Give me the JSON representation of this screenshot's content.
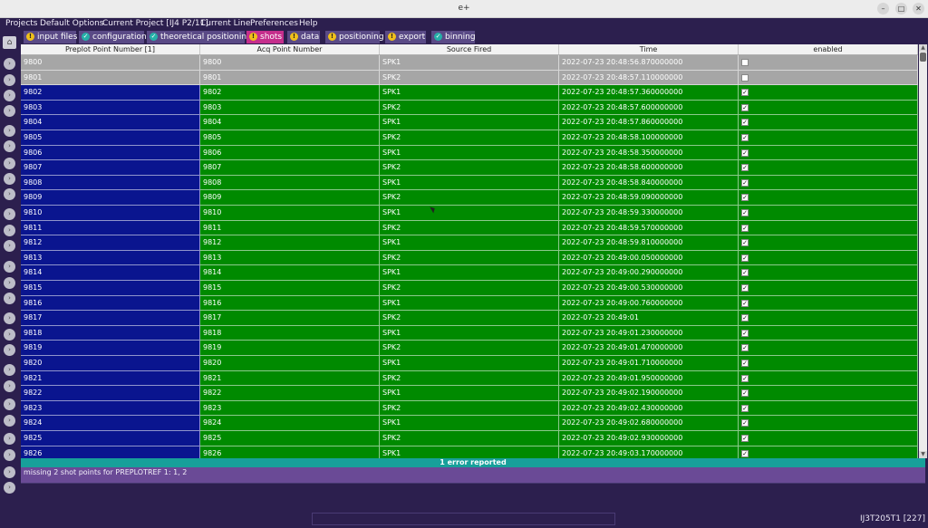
{
  "window": {
    "title": "e+"
  },
  "menu": [
    "Projects",
    "Default Options",
    "Current Project [IJ4 P2/11]",
    "Current Line",
    "Preferences",
    "Help"
  ],
  "tabs": [
    {
      "label": "input files",
      "status": "warning"
    },
    {
      "label": "configuration",
      "status": "ok"
    },
    {
      "label": "theoretical positioning",
      "status": "ok"
    },
    {
      "label": "shots",
      "status": "warning",
      "active": true
    },
    {
      "label": "data",
      "status": "warning"
    },
    {
      "label": "positioning",
      "status": "warning"
    },
    {
      "label": "export",
      "status": "warning"
    },
    {
      "label": "binning",
      "status": "ok"
    }
  ],
  "table": {
    "columns": [
      "Preplot Point Number [1]",
      "Acq Point Number",
      "Source Fired",
      "Time",
      "enabled"
    ],
    "rows": [
      {
        "preplot": "9800",
        "acq": "9800",
        "source": "SPK1",
        "time": "2022-07-23 20:48:56.870000000",
        "enabled": false
      },
      {
        "preplot": "9801",
        "acq": "9801",
        "source": "SPK2",
        "time": "2022-07-23 20:48:57.110000000",
        "enabled": false
      },
      {
        "preplot": "9802",
        "acq": "9802",
        "source": "SPK1",
        "time": "2022-07-23 20:48:57.360000000",
        "enabled": true
      },
      {
        "preplot": "9803",
        "acq": "9803",
        "source": "SPK2",
        "time": "2022-07-23 20:48:57.600000000",
        "enabled": true
      },
      {
        "preplot": "9804",
        "acq": "9804",
        "source": "SPK1",
        "time": "2022-07-23 20:48:57.860000000",
        "enabled": true
      },
      {
        "preplot": "9805",
        "acq": "9805",
        "source": "SPK2",
        "time": "2022-07-23 20:48:58.100000000",
        "enabled": true
      },
      {
        "preplot": "9806",
        "acq": "9806",
        "source": "SPK1",
        "time": "2022-07-23 20:48:58.350000000",
        "enabled": true
      },
      {
        "preplot": "9807",
        "acq": "9807",
        "source": "SPK2",
        "time": "2022-07-23 20:48:58.600000000",
        "enabled": true
      },
      {
        "preplot": "9808",
        "acq": "9808",
        "source": "SPK1",
        "time": "2022-07-23 20:48:58.840000000",
        "enabled": true
      },
      {
        "preplot": "9809",
        "acq": "9809",
        "source": "SPK2",
        "time": "2022-07-23 20:48:59.090000000",
        "enabled": true
      },
      {
        "preplot": "9810",
        "acq": "9810",
        "source": "SPK1",
        "time": "2022-07-23 20:48:59.330000000",
        "enabled": true
      },
      {
        "preplot": "9811",
        "acq": "9811",
        "source": "SPK2",
        "time": "2022-07-23 20:48:59.570000000",
        "enabled": true
      },
      {
        "preplot": "9812",
        "acq": "9812",
        "source": "SPK1",
        "time": "2022-07-23 20:48:59.810000000",
        "enabled": true
      },
      {
        "preplot": "9813",
        "acq": "9813",
        "source": "SPK2",
        "time": "2022-07-23 20:49:00.050000000",
        "enabled": true
      },
      {
        "preplot": "9814",
        "acq": "9814",
        "source": "SPK1",
        "time": "2022-07-23 20:49:00.290000000",
        "enabled": true
      },
      {
        "preplot": "9815",
        "acq": "9815",
        "source": "SPK2",
        "time": "2022-07-23 20:49:00.530000000",
        "enabled": true
      },
      {
        "preplot": "9816",
        "acq": "9816",
        "source": "SPK1",
        "time": "2022-07-23 20:49:00.760000000",
        "enabled": true
      },
      {
        "preplot": "9817",
        "acq": "9817",
        "source": "SPK2",
        "time": "2022-07-23 20:49:01",
        "enabled": true
      },
      {
        "preplot": "9818",
        "acq": "9818",
        "source": "SPK1",
        "time": "2022-07-23 20:49:01.230000000",
        "enabled": true
      },
      {
        "preplot": "9819",
        "acq": "9819",
        "source": "SPK2",
        "time": "2022-07-23 20:49:01.470000000",
        "enabled": true
      },
      {
        "preplot": "9820",
        "acq": "9820",
        "source": "SPK1",
        "time": "2022-07-23 20:49:01.710000000",
        "enabled": true
      },
      {
        "preplot": "9821",
        "acq": "9821",
        "source": "SPK2",
        "time": "2022-07-23 20:49:01.950000000",
        "enabled": true
      },
      {
        "preplot": "9822",
        "acq": "9822",
        "source": "SPK1",
        "time": "2022-07-23 20:49:02.190000000",
        "enabled": true
      },
      {
        "preplot": "9823",
        "acq": "9823",
        "source": "SPK2",
        "time": "2022-07-23 20:49:02.430000000",
        "enabled": true
      },
      {
        "preplot": "9824",
        "acq": "9824",
        "source": "SPK1",
        "time": "2022-07-23 20:49:02.680000000",
        "enabled": true
      },
      {
        "preplot": "9825",
        "acq": "9825",
        "source": "SPK2",
        "time": "2022-07-23 20:49:02.930000000",
        "enabled": true
      },
      {
        "preplot": "9826",
        "acq": "9826",
        "source": "SPK1",
        "time": "2022-07-23 20:49:03.170000000",
        "enabled": true
      }
    ]
  },
  "status": {
    "errors": "1 error reported",
    "message": "missing 2 shot points for PREPLOTREF 1: 1, 2"
  },
  "footer": {
    "line": "IJ3T205T1 [227]"
  },
  "colors": {
    "disabled_row": "#a6a6a6",
    "enabled_row": "#008a00",
    "preplot_column": "#0a158f",
    "active_tab": "#c52e8c"
  }
}
